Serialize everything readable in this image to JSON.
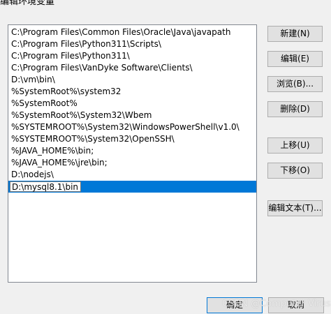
{
  "window": {
    "title": "编辑环境变量"
  },
  "path_list": {
    "items": [
      "C:\\Program Files\\Common Files\\Oracle\\Java\\javapath",
      "C:\\Program Files\\Python311\\Scripts\\",
      "C:\\Program Files\\Python311\\",
      "C:\\Program Files\\VanDyke Software\\Clients\\",
      "D:\\vm\\bin\\",
      "%SystemRoot%\\system32",
      "%SystemRoot%",
      "%SystemRoot%\\System32\\Wbem",
      "%SYSTEMROOT%\\System32\\WindowsPowerShell\\v1.0\\",
      "%SYSTEMROOT%\\System32\\OpenSSH\\",
      "%JAVA_HOME%\\bin;",
      "%JAVA_HOME%\\jre\\bin;",
      "D:\\nodejs\\"
    ],
    "editing_value": "D:\\mysql8.1\\bin"
  },
  "buttons": {
    "new": "新建(N)",
    "edit": "编辑(E)",
    "browse": "浏览(B)...",
    "delete": "删除(D)",
    "move_up": "上移(U)",
    "move_down": "下移(O)",
    "edit_text": "编辑文本(T)...",
    "ok": "确定",
    "cancel": "取消"
  },
  "watermark": "CSDN @Computer Virus",
  "colors": {
    "selection": "#0078d7",
    "dialog_bg": "#f0f0f0",
    "button_bg": "#e1e1e1"
  }
}
